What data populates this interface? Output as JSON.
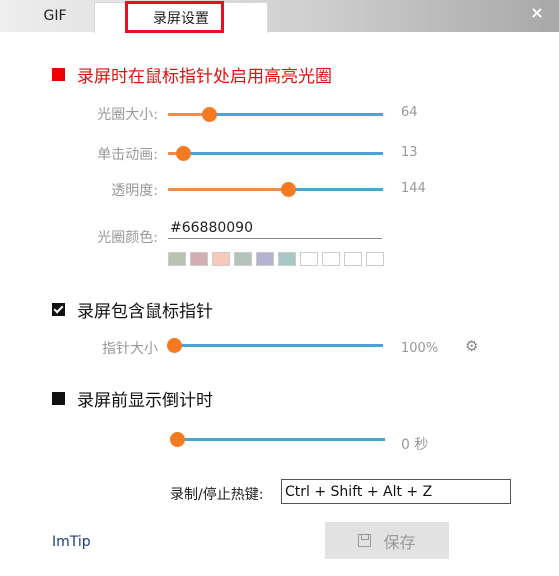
{
  "tabs": [
    {
      "label": "GIF"
    },
    {
      "label": "录屏设置"
    }
  ],
  "close_symbol": "×",
  "halo": {
    "title": "录屏时在鼠标指针处启用高亮光圈",
    "enabled_color": "#ee0000",
    "size": {
      "label": "光圈大小:",
      "value": "64",
      "fraction": 0.19
    },
    "animation": {
      "label": "单击动画:",
      "value": "13",
      "fraction": 0.07
    },
    "opacity": {
      "label": "透明度:",
      "value": "144",
      "fraction": 0.56
    },
    "color": {
      "label": "光圈颜色:",
      "value": "#66880090"
    },
    "swatches": [
      "#b6c4b0",
      "#d4aeae",
      "#f6c9b8",
      "#b4c4ba",
      "#b4b4d2",
      "#a8c8c8",
      "#ffffff",
      "#ffffff",
      "#ffffff",
      "#ffffff"
    ]
  },
  "cursor": {
    "title": "录屏包含鼠标指针",
    "checked": true,
    "size": {
      "label": "指针大小",
      "value": "100%",
      "fraction": 0.0
    },
    "settings_icon": "gear-icon"
  },
  "countdown": {
    "title": "录屏前显示倒计时",
    "value": "0 秒",
    "fraction": 0.0
  },
  "hotkey": {
    "label": "录制/停止热键:",
    "value": "Ctrl + Shift + Alt + Z"
  },
  "footer": {
    "link": "ImTip",
    "save_label": "保存",
    "save_icon": "save-icon"
  },
  "colors": {
    "accent_orange": "#f47a22",
    "track_blue": "#4aa4d4",
    "title_red": "#e01010",
    "highlight_red": "#e4121e"
  }
}
